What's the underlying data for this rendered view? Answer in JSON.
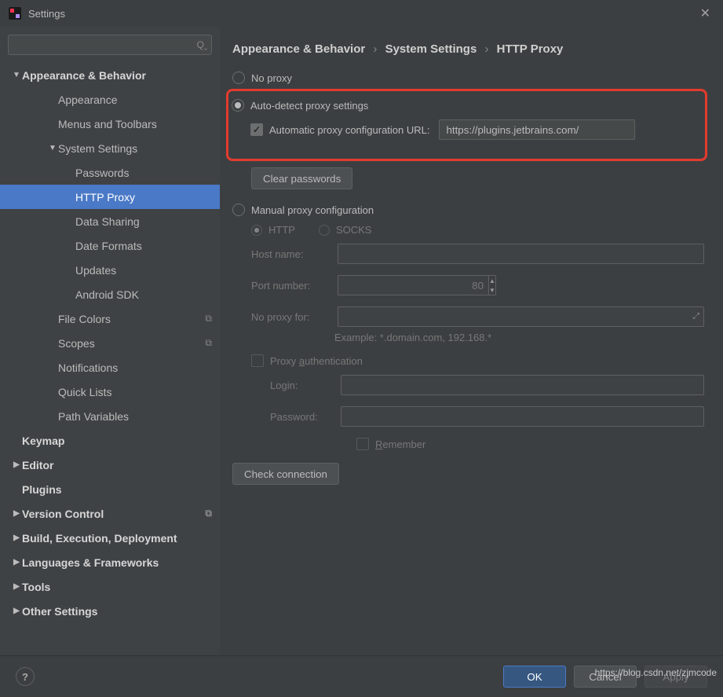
{
  "window": {
    "title": "Settings"
  },
  "search": {
    "placeholder": ""
  },
  "tree": [
    {
      "label": "Appearance & Behavior",
      "depth": 0,
      "expanded": true,
      "arrow": "▼"
    },
    {
      "label": "Appearance",
      "depth": 1
    },
    {
      "label": "Menus and Toolbars",
      "depth": 1
    },
    {
      "label": "System Settings",
      "depth": 1,
      "expanded": true,
      "arrow": "▼"
    },
    {
      "label": "Passwords",
      "depth": 2
    },
    {
      "label": "HTTP Proxy",
      "depth": 2,
      "selected": true
    },
    {
      "label": "Data Sharing",
      "depth": 2
    },
    {
      "label": "Date Formats",
      "depth": 2
    },
    {
      "label": "Updates",
      "depth": 2
    },
    {
      "label": "Android SDK",
      "depth": 2
    },
    {
      "label": "File Colors",
      "depth": 1,
      "badge": "⧉"
    },
    {
      "label": "Scopes",
      "depth": 1,
      "badge": "⧉"
    },
    {
      "label": "Notifications",
      "depth": 1
    },
    {
      "label": "Quick Lists",
      "depth": 1
    },
    {
      "label": "Path Variables",
      "depth": 1
    },
    {
      "label": "Keymap",
      "depth": 0
    },
    {
      "label": "Editor",
      "depth": 0,
      "arrow": "▶"
    },
    {
      "label": "Plugins",
      "depth": 0
    },
    {
      "label": "Version Control",
      "depth": 0,
      "arrow": "▶",
      "badge": "⧉"
    },
    {
      "label": "Build, Execution, Deployment",
      "depth": 0,
      "arrow": "▶"
    },
    {
      "label": "Languages & Frameworks",
      "depth": 0,
      "arrow": "▶"
    },
    {
      "label": "Tools",
      "depth": 0,
      "arrow": "▶"
    },
    {
      "label": "Other Settings",
      "depth": 0,
      "arrow": "▶"
    }
  ],
  "breadcrumb": {
    "part1": "Appearance & Behavior",
    "part2": "System Settings",
    "part3": "HTTP Proxy",
    "sep": "›"
  },
  "proxy": {
    "no_proxy": "No proxy",
    "auto_detect": "Auto-detect proxy settings",
    "auto_url_label": "Automatic proxy configuration URL:",
    "auto_url_value": "https://plugins.jetbrains.com/",
    "clear_passwords": "Clear passwords",
    "manual": "Manual proxy configuration",
    "http": "HTTP",
    "socks": "SOCKS",
    "host_label": "Host name:",
    "host_value": "",
    "port_label": "Port number:",
    "port_value": "80",
    "noproxy_label": "No proxy for:",
    "noproxy_value": "",
    "example": "Example: *.domain.com, 192.168.*",
    "auth_label_prefix": "Proxy ",
    "auth_label_u": "a",
    "auth_label_suffix": "uthentication",
    "login_label": "Login:",
    "login_value": "",
    "password_label": "Password:",
    "password_value": "",
    "remember_prefix": "R",
    "remember_suffix": "emember",
    "check_connection": "Check connection"
  },
  "footer": {
    "ok": "OK",
    "cancel": "Cancel",
    "apply": "Apply"
  },
  "watermark": "https://blog.csdn.net/zjmcode"
}
